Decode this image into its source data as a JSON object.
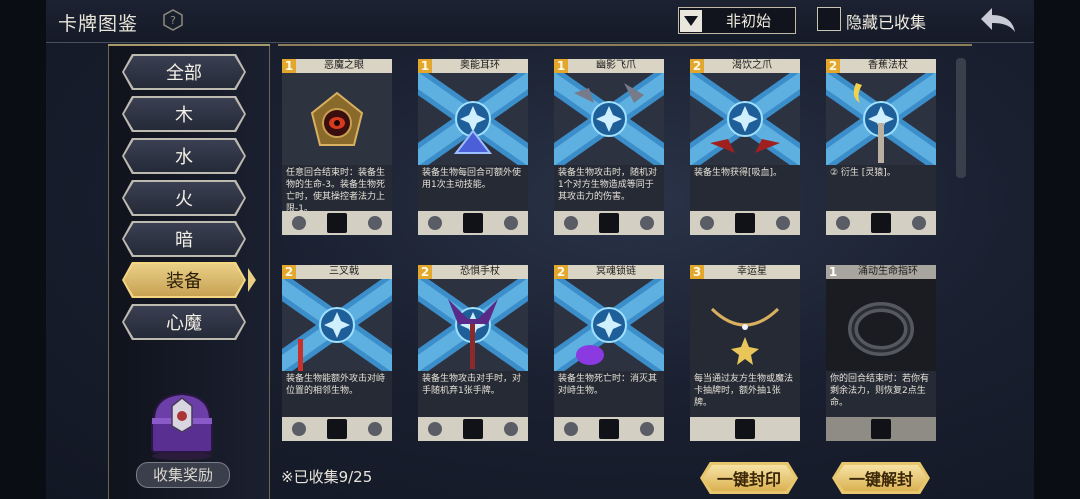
{
  "header": {
    "title": "卡牌图鉴",
    "filter_label": "非初始",
    "hide_collected_label": "隐藏已收集"
  },
  "sidebar": {
    "categories": [
      {
        "label": "全部"
      },
      {
        "label": "木"
      },
      {
        "label": "水"
      },
      {
        "label": "火"
      },
      {
        "label": "暗"
      },
      {
        "label": "装备",
        "active": true
      },
      {
        "label": "心魔"
      }
    ],
    "reward_label": "收集奖励"
  },
  "cards": [
    {
      "cost": "1",
      "name": "恶魔之眼",
      "desc": "任意回合结束时：装备生物的生命-3。装备生物死亡时，使其操控者法力上限-1。"
    },
    {
      "cost": "1",
      "name": "奥能耳环",
      "desc": "装备生物每回合可额外使用1次主动技能。"
    },
    {
      "cost": "1",
      "name": "幽影飞爪",
      "desc": "装备生物攻击时，随机对1个对方生物造成等同于其攻击力的伤害。"
    },
    {
      "cost": "2",
      "name": "渴饮之爪",
      "desc": "装备生物获得[吸血]。"
    },
    {
      "cost": "2",
      "name": "香蕉法杖",
      "desc": "② 衍生 [灵猿]。"
    },
    {
      "cost": "2",
      "name": "三叉戟",
      "desc": "装备生物能额外攻击对峙位置的相邻生物。"
    },
    {
      "cost": "2",
      "name": "恐惧手杖",
      "desc": "装备生物攻击对手时，对手随机弃1张手牌。"
    },
    {
      "cost": "2",
      "name": "冥魂锁链",
      "desc": "装备生物死亡时：消灭其对峙生物。"
    },
    {
      "cost": "3",
      "name": "幸运星",
      "desc": "每当通过友方生物或魔法卡抽牌时，额外抽1张牌。"
    },
    {
      "cost": "1",
      "name": "涌动生命指环",
      "desc": "你的回合结束时：若你有剩余法力，则恢复2点生命。"
    }
  ],
  "footer": {
    "collected": "※已收集9/25",
    "seal_all": "一键封印",
    "unseal_all": "一键解封"
  },
  "colors": {
    "accent_gold": "#e9cf86",
    "cost_orange": "#e3a72e",
    "rune_blue": "#3fa3e6"
  }
}
